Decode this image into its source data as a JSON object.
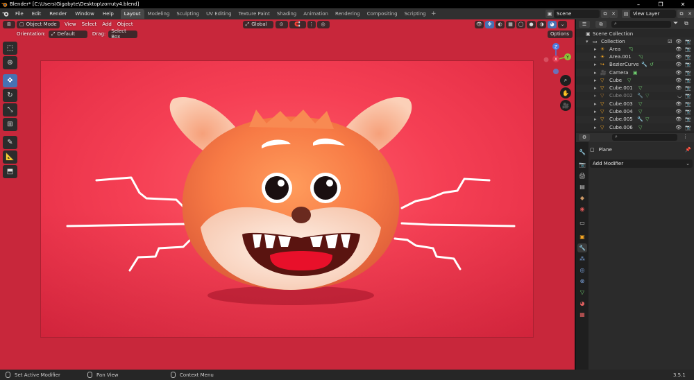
{
  "window": {
    "title": "Blender* [C:\\Users\\Gigabyte\\Desktop\\zorruty4.blend]",
    "controls": [
      "–",
      "❐",
      "✕"
    ]
  },
  "menus": [
    "File",
    "Edit",
    "Render",
    "Window",
    "Help"
  ],
  "workspaces": [
    {
      "label": "Layout",
      "active": true
    },
    {
      "label": "Modeling",
      "active": false
    },
    {
      "label": "Sculpting",
      "active": false
    },
    {
      "label": "UV Editing",
      "active": false
    },
    {
      "label": "Texture Paint",
      "active": false
    },
    {
      "label": "Shading",
      "active": false
    },
    {
      "label": "Animation",
      "active": false
    },
    {
      "label": "Rendering",
      "active": false
    },
    {
      "label": "Compositing",
      "active": false
    },
    {
      "label": "Scripting",
      "active": false
    }
  ],
  "scene": {
    "label": "Scene",
    "view_layer": "View Layer"
  },
  "viewport_header": {
    "mode": "Object Mode",
    "menus": [
      "View",
      "Select",
      "Add",
      "Object"
    ],
    "transform": "Global",
    "orientation_label": "Orientation:",
    "orientation_value": "Default",
    "drag_label": "Drag:",
    "drag_value": "Select Box",
    "options": "Options"
  },
  "gizmo": {
    "x": "X",
    "y": "Y",
    "z": "Z"
  },
  "outliner": {
    "root": "Scene Collection",
    "collection": "Collection",
    "items": [
      {
        "name": "Area",
        "type": "light",
        "dim": false
      },
      {
        "name": "Area.001",
        "type": "light",
        "dim": false
      },
      {
        "name": "BezierCurve",
        "type": "curve",
        "dim": false
      },
      {
        "name": "Camera",
        "type": "camera",
        "dim": false
      },
      {
        "name": "Cube",
        "type": "mesh",
        "dim": false
      },
      {
        "name": "Cube.001",
        "type": "mesh",
        "dim": false
      },
      {
        "name": "Cube.002",
        "type": "mesh",
        "dim": true
      },
      {
        "name": "Cube.003",
        "type": "mesh",
        "dim": false
      },
      {
        "name": "Cube.004",
        "type": "mesh",
        "dim": false
      },
      {
        "name": "Cube.005",
        "type": "mesh",
        "dim": false
      },
      {
        "name": "Cube.006",
        "type": "mesh",
        "dim": false
      }
    ]
  },
  "properties": {
    "object_name": "Plane",
    "add_modifier": "Add Modifier"
  },
  "status": {
    "left": "Set Active Modifier",
    "middle": "Pan View",
    "right": "Context Menu",
    "version": "3.5.1"
  },
  "colors": {
    "accent": "#4772b3",
    "viewport_bg": "#c8273b",
    "camera_bg": "#f53f54"
  }
}
